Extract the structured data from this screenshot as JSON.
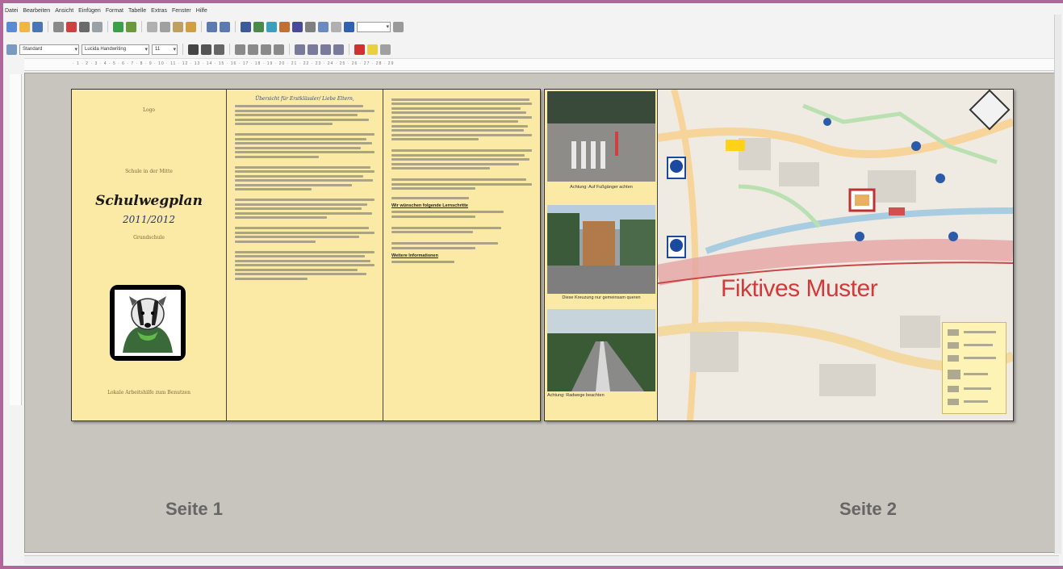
{
  "menu": [
    "Datei",
    "Bearbeiten",
    "Ansicht",
    "Einfügen",
    "Format",
    "Tabelle",
    "Extras",
    "Fenster",
    "Hilfe"
  ],
  "toolbar": {
    "style_value": "Standard",
    "font_value": "Lucida Handwriting",
    "size_value": "11"
  },
  "page1": {
    "col1": {
      "small_top": "Logo",
      "school": "Schule in der Mitte",
      "title": "Schulwegplan",
      "year": "2011/2012",
      "grundschule": "Grundschule",
      "footer": "Lokale Arbeitshilfe zum Benutzen"
    },
    "col2": {
      "heading": "Übersicht für Erstklässler/ Liebe Eltern,"
    },
    "col3": {
      "section1": "Wir wünschen folgende Lernschritte",
      "section2": "Weitere Informationen"
    }
  },
  "page2": {
    "captions": [
      "Achtung: Auf Fußgänger achten",
      "Diese Kreuzung nur gemeinsam queren",
      "Achtung: Radwege beachten"
    ],
    "watermark": "Fiktives Muster"
  },
  "labels": {
    "seite1": "Seite 1",
    "seite2": "Seite 2"
  },
  "colors": {
    "frame": "#b0689a",
    "leaflet": "#fbe9a6",
    "watermark": "#d23a3a"
  }
}
